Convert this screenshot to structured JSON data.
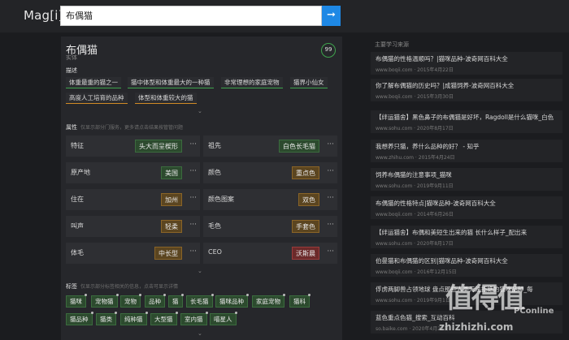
{
  "header": {
    "logo": "Mag[i]",
    "search_value": "布偶猫",
    "search_icon": "arrow-right-icon"
  },
  "entity": {
    "title": "布偶猫",
    "type": "实体",
    "score": "99"
  },
  "description": {
    "label": "描述",
    "chips": [
      "体重最重的猫之一",
      "猫中体型和体重最大的一种猫",
      "非常理想的家庭宠物",
      "猫界小仙女",
      "高度人工培育的品种",
      "体型和体重较大的猫"
    ]
  },
  "attributes": {
    "label": "属性",
    "hint": "仅显示部分门服务，更多请点击结果按管管问题",
    "rows": [
      {
        "name": "特征",
        "value": "头大而呈楔形"
      },
      {
        "name": "祖先",
        "value": "白色长毛猫"
      },
      {
        "name": "原产地",
        "value": "美国"
      },
      {
        "name": "颜色",
        "value": "重点色"
      },
      {
        "name": "住在",
        "value": "加州"
      },
      {
        "name": "颜色图案",
        "value": "双色"
      },
      {
        "name": "叫声",
        "value": "轻柔"
      },
      {
        "name": "毛色",
        "value": "手套色"
      },
      {
        "name": "体毛",
        "value": "中长型"
      },
      {
        "name": "CEO",
        "value": "沃斯晨"
      }
    ],
    "more": "···"
  },
  "tags": {
    "label": "标签",
    "hint": "仅显示部分标签相关的信息，点击可显示详情",
    "items": [
      "猫咪",
      "宠物猫",
      "宠物",
      "品种",
      "猫",
      "长毛猫",
      "猫咪品种",
      "家庭宠物",
      "猫科",
      "猫品种",
      "猫类",
      "纯种猫",
      "大型猫",
      "室内猫",
      "喵星人"
    ]
  },
  "sources": {
    "title": "主要学习来源",
    "items": [
      {
        "title": "布偶猫的性格温顺吗？|猫咪品种-波奇网百科大全",
        "meta": "www.boqii.com · 2015年4月22日"
      },
      {
        "title": "你了解布偶猫的历史吗？|成猫饲养-波奇网百科大全",
        "meta": "www.boqii.com · 2015年3月30日"
      },
      {
        "title": "【绊运猫舍】黑色鼻子的布偶猫是好坏，Ragdoll是什么猫咪_白色",
        "meta": "www.sohu.com · 2020年8月17日"
      },
      {
        "title": "我想养只猫，养什么品种的好？ - 知乎",
        "meta": "www.zhihu.com · 2015年4月24日"
      },
      {
        "title": "饲养布偶猫的注意事项_猫咪",
        "meta": "www.sohu.com · 2019年9月11日"
      },
      {
        "title": "布偶猫的性格特点|猫咪品种-波奇网百科大全",
        "meta": "www.boqii.com · 2014年6月26日"
      },
      {
        "title": "【绊运猫舍】布偶和美短生出来的猫 长什么样子_配出来",
        "meta": "www.sohu.com · 2020年8月17日"
      },
      {
        "title": "伯曼猫和布偶猫的区别|猫咪品种-波奇网百科大全",
        "meta": "www.boqii.com · 2016年12月15日"
      },
      {
        "title": "俘虏两脚兽占领地球 盘点那些人类无法拒绝的猫咪品种_每",
        "meta": "www.sohu.com · 2019年9月1日"
      },
      {
        "title": "蓝色重点色猫_搜索_互动百科",
        "meta": "so.baike.com · 2020年4月22日"
      }
    ]
  },
  "watermark": {
    "main": "值得值",
    "sub": "PConline",
    "url": "zhizhizhi.com"
  },
  "colors": {
    "accent_blue": "#1e88e5",
    "green": "#3fa34d",
    "orange": "#d08a26",
    "red": "#9a3b3b"
  }
}
